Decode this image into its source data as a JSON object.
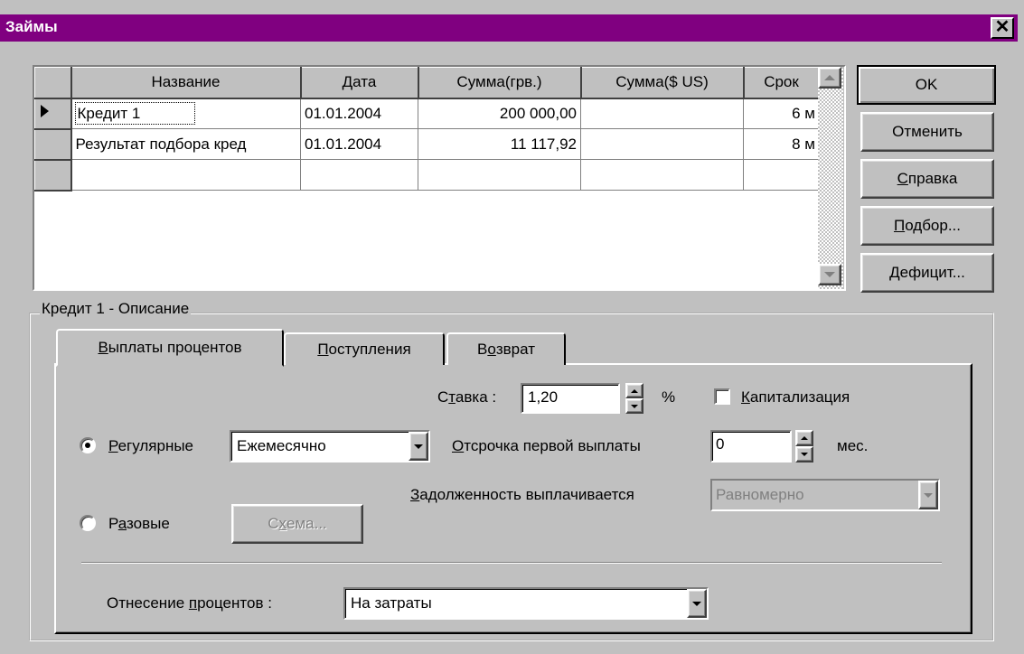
{
  "window": {
    "title": "Займы",
    "close": "✕"
  },
  "grid": {
    "columns": [
      "Название",
      "Дата",
      "Сумма(грв.)",
      "Сумма($ US)",
      "Срок"
    ],
    "rows": [
      {
        "name": "Кредит 1",
        "date": "01.01.2004",
        "uah": "200 000,00",
        "usd": "",
        "term": "6 м",
        "current": true
      },
      {
        "name": "Результат подбора кред",
        "date": "01.01.2004",
        "uah": "11 117,92",
        "usd": "",
        "term": "8 м",
        "current": false
      },
      {
        "name": "",
        "date": "",
        "uah": "",
        "usd": "",
        "term": "",
        "current": false
      }
    ]
  },
  "buttons": {
    "ok": "OK",
    "cancel": "Отменить",
    "help_u": "С",
    "help_rest": "правка",
    "select_u": "П",
    "select_rest": "одбор...",
    "deficit_u": "Д",
    "deficit_rest": "ефицит..."
  },
  "group": {
    "label": "Кредит 1 - Описание"
  },
  "tabs": {
    "interest_u": "В",
    "interest_rest": "ыплаты процентов",
    "receipts_u": "П",
    "receipts_rest": "оступления",
    "return_pre": "В",
    "return_u": "о",
    "return_rest": "зврат"
  },
  "form": {
    "rate_pre": "С",
    "rate_u": "т",
    "rate_rest": "авка :",
    "rate_value": "1,20",
    "percent_sign": "%",
    "cap_u": "К",
    "cap_rest": "апитализация",
    "capitalization": false,
    "regular_u": "Р",
    "regular_rest": "егулярные",
    "regular_selected": true,
    "periodicity": "Ежемесячно",
    "deferral_u": "О",
    "deferral_rest": "тсрочка первой выплаты",
    "deferral_value": "0",
    "months": "мес.",
    "debt_u": "З",
    "debt_rest": "адолженность выплачивается",
    "debt_mode": "Равномерно",
    "onetime_pre": "Р",
    "onetime_u": "а",
    "onetime_rest": "зовые",
    "scheme_pre": "С",
    "scheme_u": "х",
    "scheme_rest": "ема...",
    "attribution_pre": "Отнесение ",
    "attribution_u": "п",
    "attribution_rest": "роцентов :",
    "attribution_value": "На затраты"
  }
}
